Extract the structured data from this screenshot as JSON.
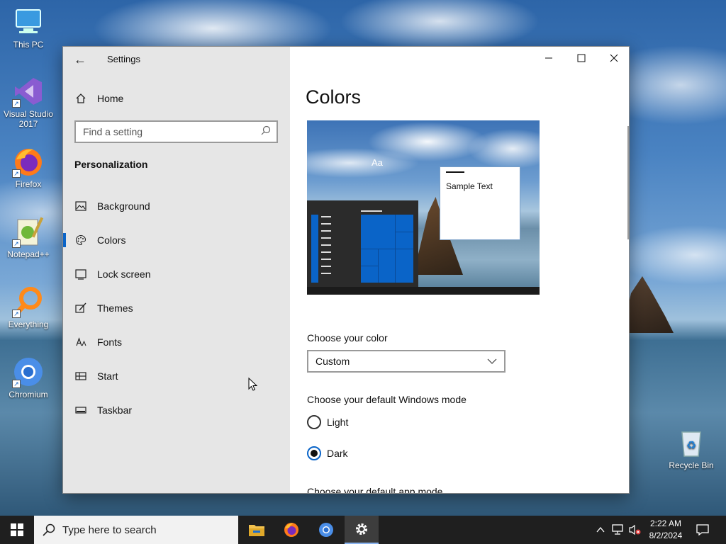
{
  "desktop": {
    "icons": [
      {
        "label": "This PC",
        "icon": "computer-icon"
      },
      {
        "label": "Visual Studio 2017",
        "icon": "visual-studio-icon"
      },
      {
        "label": "Firefox",
        "icon": "firefox-icon"
      },
      {
        "label": "Notepad++",
        "icon": "notepadpp-icon"
      },
      {
        "label": "Everything",
        "icon": "everything-search-icon"
      },
      {
        "label": "Chromium",
        "icon": "chromium-icon"
      }
    ],
    "recycle_bin": {
      "label": "Recycle Bin",
      "icon": "recycle-bin-icon"
    }
  },
  "window": {
    "title": "Settings",
    "accent_color": "#0a64c8"
  },
  "sidebar": {
    "home_label": "Home",
    "search_placeholder": "Find a setting",
    "section": "Personalization",
    "items": [
      {
        "label": "Background",
        "icon": "picture-icon",
        "active": false
      },
      {
        "label": "Colors",
        "icon": "palette-icon",
        "active": true
      },
      {
        "label": "Lock screen",
        "icon": "lock-screen-icon",
        "active": false
      },
      {
        "label": "Themes",
        "icon": "themes-brush-icon",
        "active": false
      },
      {
        "label": "Fonts",
        "icon": "fonts-icon",
        "active": false
      },
      {
        "label": "Start",
        "icon": "start-grid-icon",
        "active": false
      },
      {
        "label": "Taskbar",
        "icon": "taskbar-icon",
        "active": false
      }
    ]
  },
  "content": {
    "title": "Colors",
    "preview": {
      "aa": "Aa",
      "sample_text": "Sample Text"
    },
    "choose_color_label": "Choose your color",
    "choose_color_value": "Custom",
    "windows_mode_label": "Choose your default Windows mode",
    "windows_mode_options": [
      {
        "label": "Light",
        "checked": false
      },
      {
        "label": "Dark",
        "checked": true
      }
    ],
    "app_mode_label": "Choose your default app mode"
  },
  "taskbar": {
    "search_placeholder": "Type here to search",
    "apps": [
      "file-explorer-icon",
      "firefox-icon",
      "chromium-icon",
      "settings-gear-icon"
    ],
    "clock_time": "2:22 AM",
    "clock_date": "8/2/2024"
  }
}
